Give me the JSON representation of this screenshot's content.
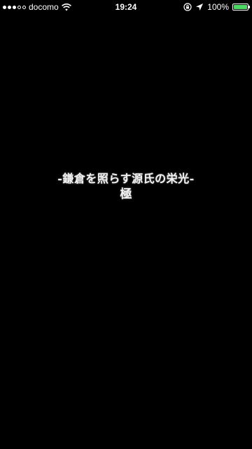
{
  "status_bar": {
    "carrier": "docomo",
    "time": "19:24",
    "battery_percent": "100%",
    "battery_level": 1.0,
    "battery_color": "#4cd964",
    "signal_strength": 3,
    "signal_max": 5,
    "icons": [
      "wifi-icon",
      "orientation-lock-icon",
      "location-arrow-icon",
      "battery-icon"
    ]
  },
  "content": {
    "title_line1": "-鎌倉を照らす源氏の栄光-",
    "title_line2": "極"
  },
  "colors": {
    "background": "#000000",
    "text": "#f2f2f2"
  }
}
